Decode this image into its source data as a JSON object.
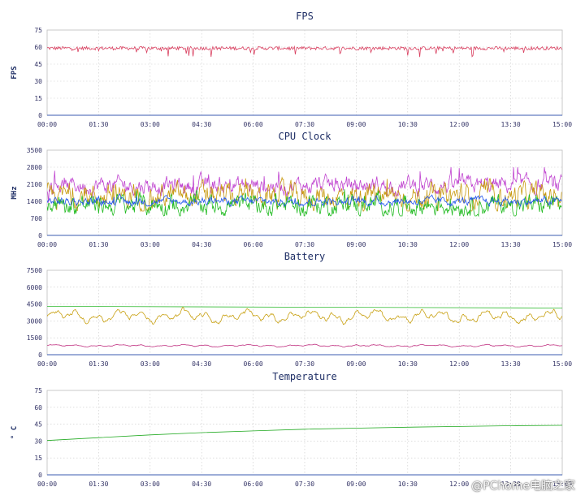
{
  "watermark": "@PChome电脑之家",
  "chart_data": [
    {
      "type": "line",
      "title": "FPS",
      "ylabel": "FPS",
      "xlabel": "",
      "ylim": [
        0,
        75
      ],
      "yticks": [
        "0",
        "15",
        "30",
        "45",
        "60",
        "75"
      ],
      "xticks": [
        "00:00",
        "01:30",
        "03:00",
        "04:30",
        "06:00",
        "07:30",
        "09:00",
        "10:30",
        "12:00",
        "13:30",
        "15:00"
      ],
      "xlim_minutes": [
        0,
        900
      ],
      "grid": true,
      "series": [
        {
          "color": "#d94060",
          "pattern": "jitter",
          "base": 59,
          "amp": 1.5,
          "drop": 7,
          "dropRate": 0.06,
          "min": 48,
          "max": 62
        }
      ]
    },
    {
      "type": "line",
      "title": "CPU Clock",
      "ylabel": "MHz",
      "xlabel": "",
      "ylim": [
        0,
        3500
      ],
      "yticks": [
        "0",
        "700",
        "1400",
        "2100",
        "2800",
        "3500"
      ],
      "xticks": [
        "00:00",
        "01:30",
        "03:00",
        "04:30",
        "06:00",
        "07:30",
        "09:00",
        "10:30",
        "12:00",
        "13:30",
        "15:00"
      ],
      "xlim_minutes": [
        0,
        900
      ],
      "grid": true,
      "series": [
        {
          "color": "#c044d0",
          "pattern": "noise",
          "base": 2050,
          "amp": 250,
          "spike": 600,
          "spikeRate": 0.04,
          "min": 1300,
          "max": 2800
        },
        {
          "color": "#c89a10",
          "pattern": "noise",
          "base": 1600,
          "amp": 350,
          "spike": 500,
          "spikeRate": 0.04,
          "min": 1000,
          "max": 2750
        },
        {
          "color": "#22bb22",
          "pattern": "noise",
          "base": 1250,
          "amp": 300,
          "spike": 300,
          "spikeRate": 0.03,
          "min": 800,
          "max": 1900
        },
        {
          "color": "#2255ee",
          "pattern": "noise",
          "base": 1400,
          "amp": 120,
          "spike": 200,
          "spikeRate": 0.01,
          "min": 1200,
          "max": 1900
        }
      ]
    },
    {
      "type": "line",
      "title": "Battery",
      "ylabel": "",
      "xlabel": "",
      "ylim": [
        0,
        7500
      ],
      "yticks": [
        "0",
        "1500",
        "3000",
        "4500",
        "6000",
        "7500"
      ],
      "xticks": [
        "00:00",
        "01:30",
        "03:00",
        "04:30",
        "06:00",
        "07:30",
        "09:00",
        "10:30",
        "12:00",
        "13:30",
        "15:00"
      ],
      "xlim_minutes": [
        0,
        900
      ],
      "grid": true,
      "series": [
        {
          "color": "#33bb33",
          "pattern": "linear",
          "start": 4300,
          "end": 4150
        },
        {
          "color": "#c8a010",
          "pattern": "wave",
          "base": 3400,
          "amp": 700,
          "min": 2300,
          "max": 4600
        },
        {
          "color": "#c03080",
          "pattern": "wave",
          "base": 800,
          "amp": 120,
          "min": 550,
          "max": 1100
        }
      ]
    },
    {
      "type": "line",
      "title": "Temperature",
      "ylabel": "° C",
      "xlabel": "",
      "ylim": [
        0,
        75
      ],
      "yticks": [
        "0",
        "15",
        "30",
        "45",
        "60",
        "75"
      ],
      "xticks": [
        "00:00",
        "01:30",
        "03:00",
        "04:30",
        "06:00",
        "07:30",
        "09:00",
        "10:30",
        "12:00",
        "13:30",
        "15:00"
      ],
      "xlim_minutes": [
        0,
        900
      ],
      "grid": true,
      "series": [
        {
          "color": "#22aa22",
          "pattern": "curve",
          "points": [
            [
              0,
              30.5
            ],
            [
              90,
              33
            ],
            [
              180,
              35.5
            ],
            [
              270,
              37.5
            ],
            [
              360,
              39
            ],
            [
              450,
              40.5
            ],
            [
              540,
              41.5
            ],
            [
              630,
              42.3
            ],
            [
              720,
              43
            ],
            [
              810,
              43.6
            ],
            [
              900,
              44
            ]
          ]
        }
      ]
    }
  ]
}
